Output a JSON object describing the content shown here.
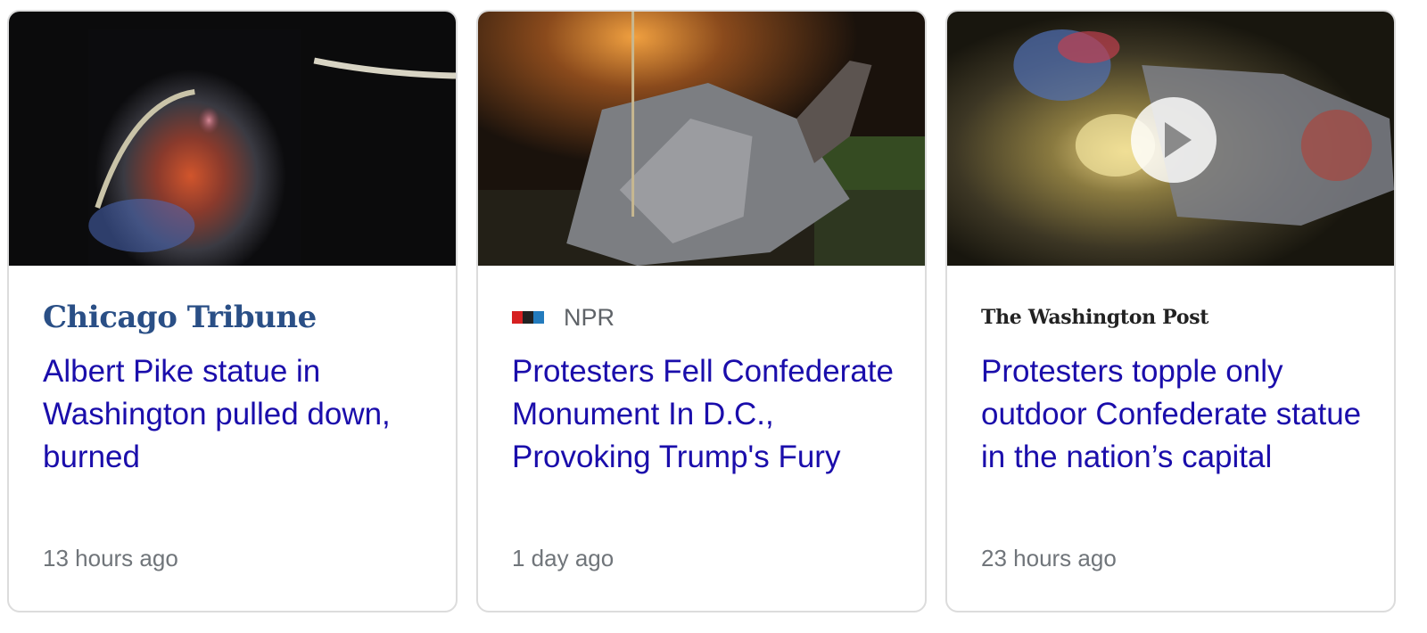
{
  "cards": [
    {
      "publisher": "Chicago Tribune",
      "headline": "Albert Pike statue in Washington pulled down, burned",
      "time": "13 hours ago"
    },
    {
      "publisher": "NPR",
      "headline": "Protesters Fell Confederate Monument In D.C., Provoking Trump's Fury",
      "time": "1 day ago"
    },
    {
      "publisher": "The Washington Post",
      "headline": "Protesters topple only outdoor Confederate statue in the nation’s capital",
      "time": "23 hours ago",
      "has_video": true
    }
  ],
  "colors": {
    "headline": "#1a0dab",
    "meta": "#70757a",
    "border": "#dcdcdc",
    "tribune_blue": "#2a4f86",
    "npr_red": "#d62021",
    "npr_black": "#222222",
    "npr_blue": "#237bbd"
  },
  "icons": {
    "npr_logo": "npr-logo-icon",
    "video": "play-icon"
  }
}
